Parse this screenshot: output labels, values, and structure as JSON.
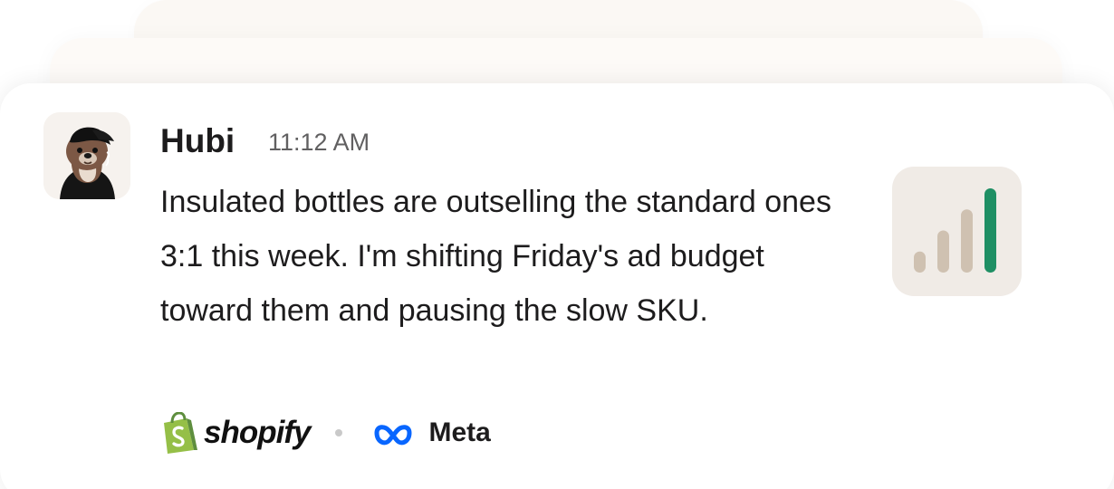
{
  "message": {
    "sender": "Hubi",
    "time": "11:12 AM",
    "text": "Insulated bottles are outselling the standard ones 3:1 this week. I'm shifting Friday's ad budget toward them and pausing the slow SKU."
  },
  "integrations": [
    {
      "name": "shopify",
      "icon": "shopify-bag-icon",
      "color": "#95bf47"
    },
    {
      "name": "Meta",
      "icon": "meta-infinity-icon",
      "color": "#0866ff"
    }
  ],
  "chart_data": {
    "type": "bar",
    "categories": [
      "1",
      "2",
      "3",
      "4"
    ],
    "values": [
      1,
      2,
      3,
      4
    ],
    "colors": [
      "#cfc1b1",
      "#cfc1b1",
      "#cfc1b1",
      "#1f8f64"
    ]
  },
  "colors": {
    "card_background": "#ffffff",
    "card_stack_background": "#fbf8f4",
    "chart_tile_background": "#f0ebe6",
    "text_primary": "#1d1c1d",
    "text_secondary": "#616061"
  }
}
